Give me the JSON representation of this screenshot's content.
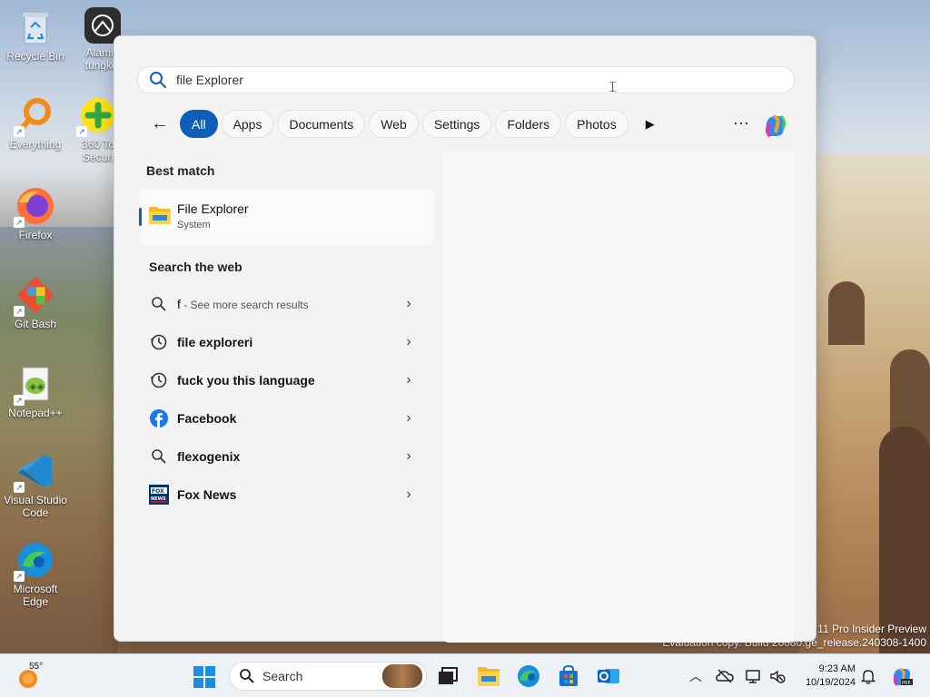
{
  "desktop": {
    "icons": [
      {
        "label": "Recycle Bin",
        "icon": "recycle-bin-icon"
      },
      {
        "label": "Alamin tungkol",
        "icon": "learn-about-icon"
      },
      {
        "label": "Everything",
        "icon": "everything-search-icon"
      },
      {
        "label": "360 To Securi",
        "icon": "360-security-icon"
      },
      {
        "label": "Firefox",
        "icon": "firefox-icon"
      },
      {
        "label": "Git Bash",
        "icon": "git-bash-icon"
      },
      {
        "label": "Notepad++",
        "icon": "notepad-plus-plus-icon"
      },
      {
        "label": "Visual Studio Code",
        "icon": "vscode-icon"
      },
      {
        "label": "Microsoft Edge",
        "icon": "edge-icon"
      }
    ],
    "watermark": {
      "line1": "11 Pro Insider Preview",
      "line2": "Evaluation copy. Build 26080.ge_release.240308-1400"
    }
  },
  "search_panel": {
    "search": {
      "value": "file Explorer",
      "placeholder": ""
    },
    "filters": [
      "All",
      "Apps",
      "Documents",
      "Web",
      "Settings",
      "Folders",
      "Photos"
    ],
    "active_filter": "All",
    "more_label": "···",
    "best_match": {
      "title": "Best match",
      "item": {
        "name": "File Explorer",
        "subtitle": "System",
        "icon": "file-explorer-folder-icon"
      }
    },
    "web": {
      "title": "Search the web",
      "items": [
        {
          "text": "f",
          "suffix": " - See more search results",
          "icon": "search-icon"
        },
        {
          "text": "file exploreri",
          "suffix": "",
          "icon": "history-icon"
        },
        {
          "text": "fuck you this language",
          "suffix": "",
          "icon": "history-icon"
        },
        {
          "text": "Facebook",
          "suffix": "",
          "icon": "facebook-icon"
        },
        {
          "text": "flexogenix",
          "suffix": "",
          "icon": "search-icon"
        },
        {
          "text": "Fox News",
          "suffix": "",
          "icon": "fox-news-icon"
        }
      ]
    }
  },
  "taskbar": {
    "weather_temp": "55°",
    "search_label": "Search",
    "apps": [
      "file-explorer-icon",
      "edge-icon",
      "store-icon",
      "outlook-icon",
      "task-view-icon"
    ],
    "time": "9:23 AM",
    "date": "10/19/2024"
  },
  "colors": {
    "accent": "#0f5fb8",
    "panel_bg": "#f3f3f3",
    "taskbar_bg": "#eef1f5"
  }
}
